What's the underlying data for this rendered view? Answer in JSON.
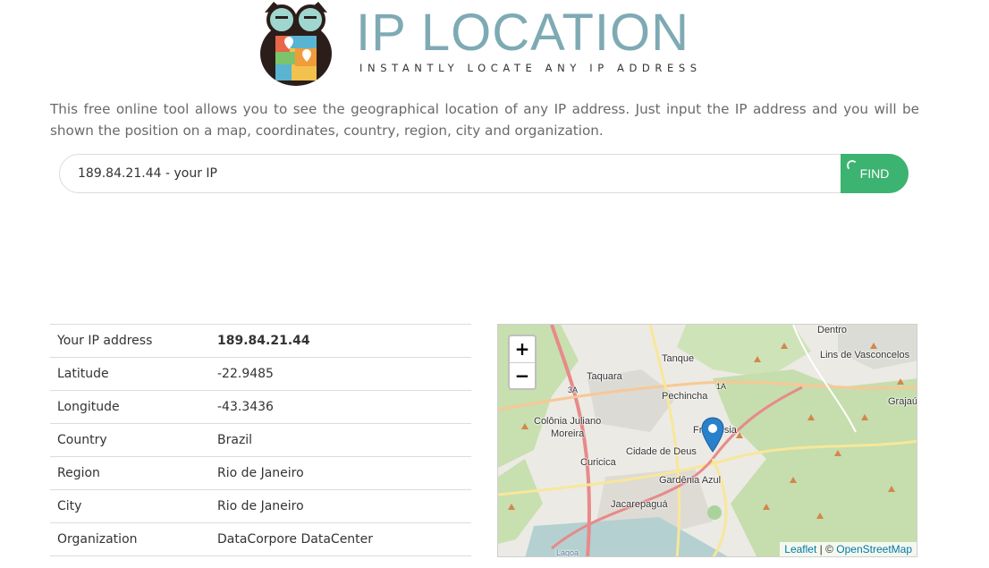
{
  "header": {
    "title": "IP LOCATION",
    "tagline": "INSTANTLY LOCATE ANY IP ADDRESS",
    "logo_icon": "owl-logo-icon"
  },
  "intro_text": "This free online tool allows you to see the geographical location of any IP address. Just input the IP address and you will be shown the position on a map, coordinates, country, region, city and organization.",
  "search": {
    "value": "189.84.21.44 - your IP",
    "button_label": "FIND"
  },
  "info": {
    "rows": [
      {
        "label": "Your IP address",
        "value": "189.84.21.44"
      },
      {
        "label": "Latitude",
        "value": "-22.9485"
      },
      {
        "label": "Longitude",
        "value": "-43.3436"
      },
      {
        "label": "Country",
        "value": "Brazil"
      },
      {
        "label": "Region",
        "value": "Rio de Janeiro"
      },
      {
        "label": "City",
        "value": "Rio de Janeiro"
      },
      {
        "label": "Organization",
        "value": "DataCorpore DataCenter"
      }
    ]
  },
  "map": {
    "zoom_in": "+",
    "zoom_out": "−",
    "attribution": {
      "leaflet": "Leaflet",
      "sep": " | © ",
      "osm": "OpenStreetMap"
    },
    "place_labels": {
      "dentro": "Dentro",
      "lins": "Lins de Vasconcelos",
      "tanque": "Tanque",
      "taquara": "Taquara",
      "pechincha": "Pechincha",
      "grajau": "Grajaú",
      "colonia": "Colônia Juliano",
      "moreira": "Moreira",
      "freguesia": "Freguesia",
      "cidade_deus": "Cidade de Deus",
      "curicica": "Curicica",
      "gardenia": "Gardênia Azul",
      "jacarepagua": "Jacarepaguá",
      "lagoa": "Lagoa",
      "road_3a": "3A",
      "road_1a": "1A"
    }
  },
  "colors": {
    "brand_teal": "#7eaab4",
    "find_green": "#3cb371",
    "marker_blue": "#2a81cb"
  }
}
